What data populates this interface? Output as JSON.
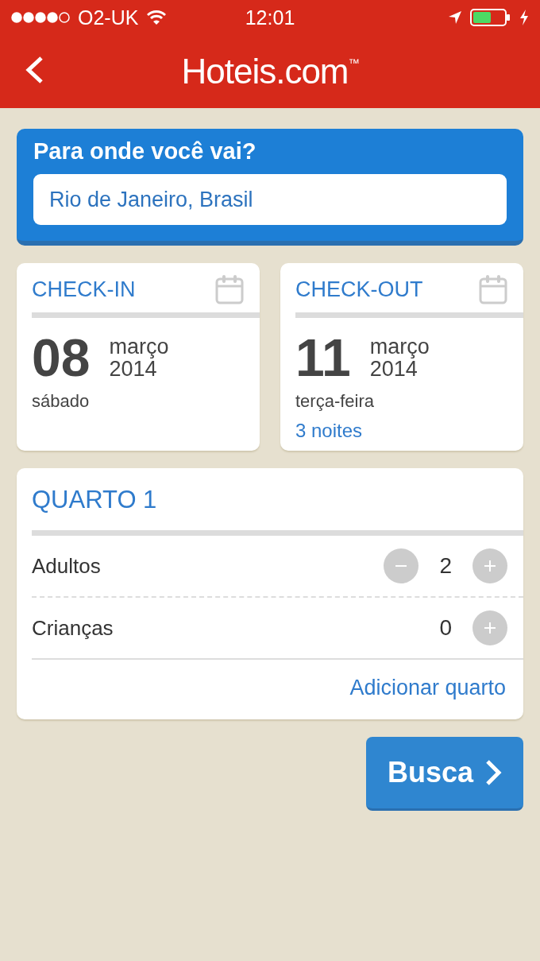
{
  "status_bar": {
    "carrier": "O2-UK",
    "time": "12:01"
  },
  "header": {
    "title": "Hoteis.com$^{™}$"
  },
  "destination": {
    "label": "Para onde você vai?",
    "value": "Rio de Janeiro, Brasil"
  },
  "dates": [
    {
      "label": "CHECK-IN",
      "day": "08",
      "month": "março",
      "year": "2014",
      "weekday": "sábado"
    },
    {
      "label": "CHECK-OUT",
      "day": "11",
      "month": "março",
      "year": "2014",
      "weekday": "terça-feira",
      "nights": "3 noites"
    }
  ],
  "room": {
    "title": "QUARTO 1",
    "rows": [
      {
        "label": "Adultos",
        "count": "2",
        "decrement": true
      },
      {
        "label": "Crianças",
        "count": "0",
        "decrement": false
      }
    ],
    "add_link": "Adicionar quarto"
  },
  "search_button": {
    "label": "Busca"
  }
}
